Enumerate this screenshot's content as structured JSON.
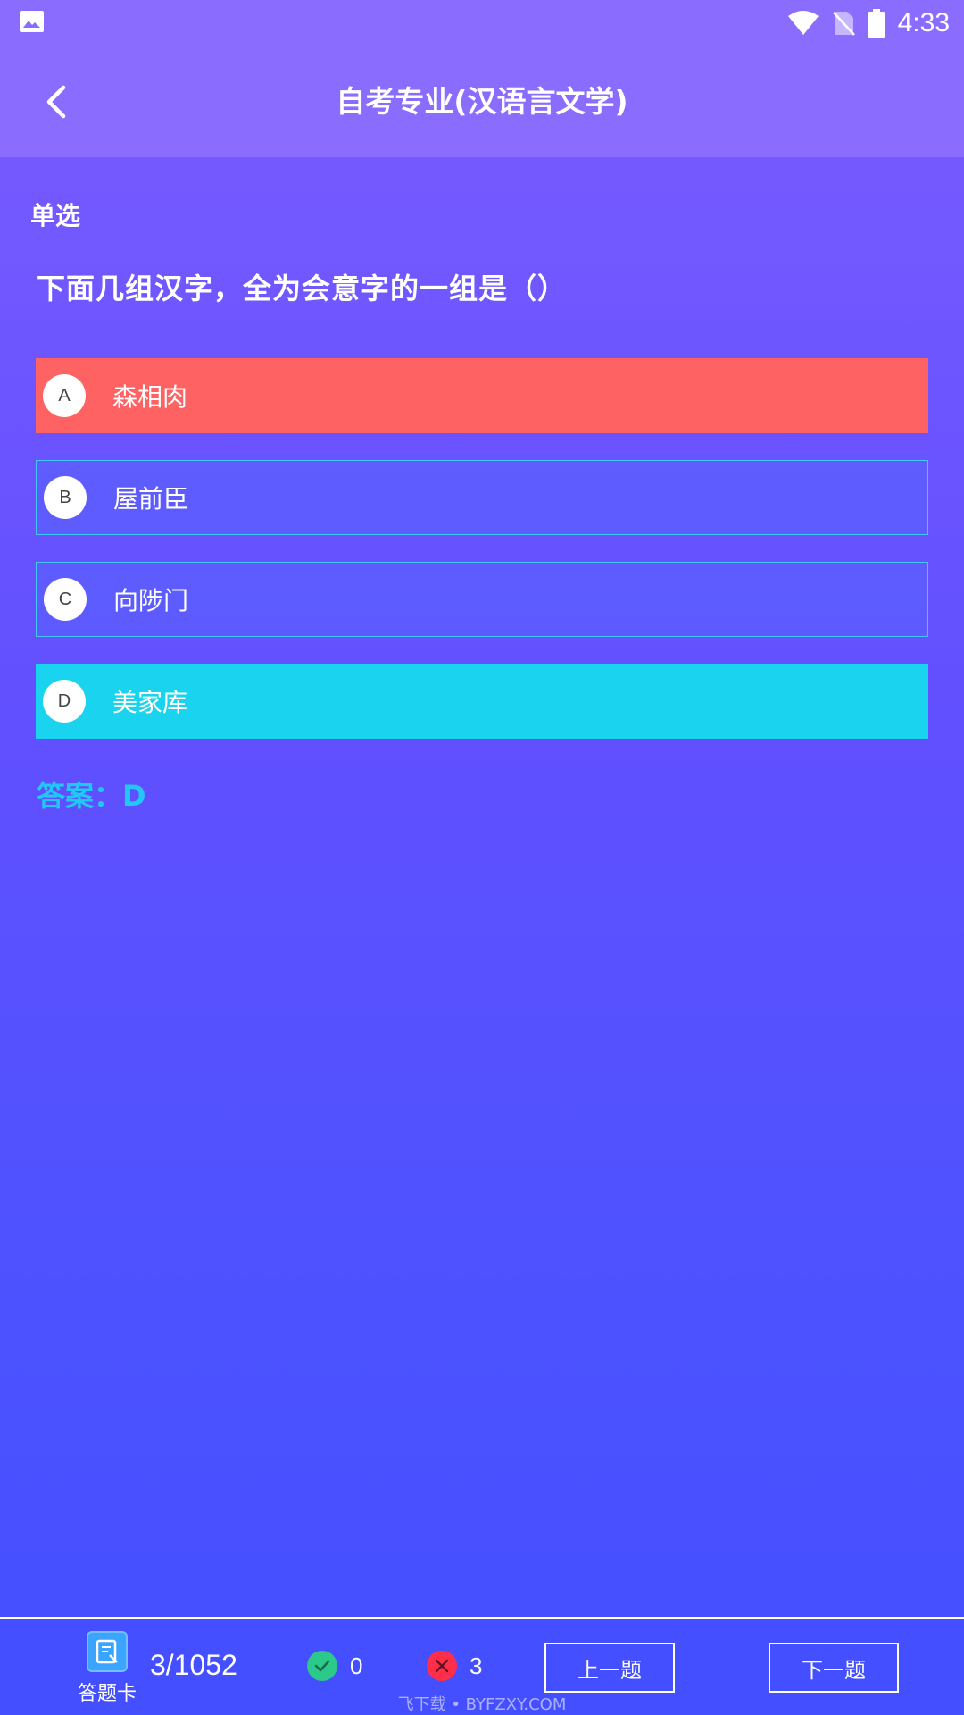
{
  "status_bar": {
    "time": "4:33",
    "icons": [
      "gallery-icon",
      "wifi-icon",
      "no-sim-icon",
      "battery-icon"
    ]
  },
  "header": {
    "title": "自考专业(汉语言文学)",
    "back_icon": "chevron-left-icon"
  },
  "question": {
    "type": "单选",
    "text": "下面几组汉字，全为会意字的一组是（）",
    "options": [
      {
        "letter": "A",
        "text": "森相肉",
        "state": "wrong"
      },
      {
        "letter": "B",
        "text": "屋前臣",
        "state": "normal"
      },
      {
        "letter": "C",
        "text": "向陟门",
        "state": "normal"
      },
      {
        "letter": "D",
        "text": "美家库",
        "state": "correct"
      }
    ],
    "answer": "答案：D"
  },
  "bottom_bar": {
    "card_label": "答题卡",
    "progress": "3/1052",
    "correct_count": "0",
    "wrong_count": "3",
    "prev_label": "上一题",
    "next_label": "下一题",
    "watermark": "飞下载 • BYFZXY.COM"
  },
  "colors": {
    "header_bg": "#8a6cff",
    "wrong_option": "#ff6262",
    "correct_option": "#1ad3ee",
    "answer_text": "#22c8f4",
    "correct_icon": "#2bc98a",
    "wrong_icon": "#ff2f4a"
  }
}
